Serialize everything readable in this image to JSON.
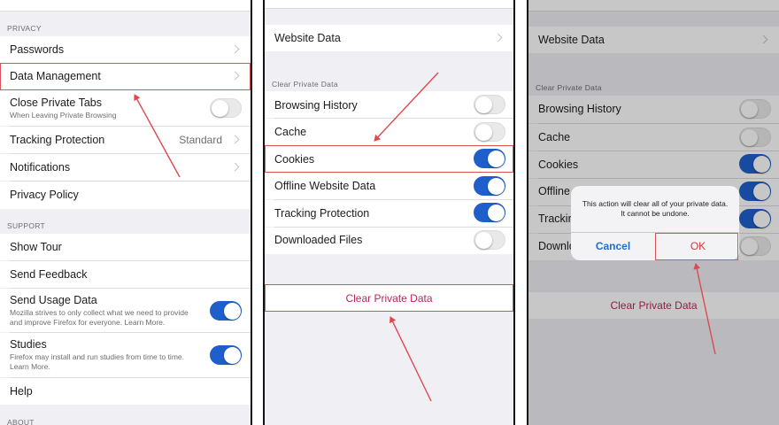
{
  "colors": {
    "accent": "#1f5fcc",
    "highlight": "#d9545a",
    "destructive": "#c0245c"
  },
  "panel1": {
    "privacy_header": "PRIVACY",
    "passwords": "Passwords",
    "data_management": "Data Management",
    "close_private_tabs": "Close Private Tabs",
    "close_private_tabs_sub": "When Leaving Private Browsing",
    "tracking_protection": "Tracking Protection",
    "tracking_protection_value": "Standard",
    "notifications": "Notifications",
    "privacy_policy": "Privacy Policy",
    "support_header": "SUPPORT",
    "show_tour": "Show Tour",
    "send_feedback": "Send Feedback",
    "send_usage_data": "Send Usage Data",
    "send_usage_data_sub1": "Mozilla strives to only collect what we need to provide",
    "send_usage_data_sub2": "and improve Firefox for everyone. Learn More.",
    "studies": "Studies",
    "studies_sub1": "Firefox may install and run studies from time to time.",
    "studies_sub2": "Learn More.",
    "help": "Help",
    "about_header": "ABOUT"
  },
  "panel2": {
    "website_data": "Website Data",
    "clear_header": "Clear Private Data",
    "browsing_history": "Browsing History",
    "cache": "Cache",
    "cookies": "Cookies",
    "offline_website_data": "Offline Website Data",
    "tracking_protection": "Tracking Protection",
    "downloaded_files": "Downloaded Files",
    "clear_button": "Clear Private Data"
  },
  "panel3": {
    "website_data": "Website Data",
    "clear_header": "Clear Private Data",
    "browsing_history": "Browsing History",
    "cache": "Cache",
    "cookies": "Cookies",
    "offline": "Offline",
    "tracking": "Trackin",
    "downloaded": "Downlo",
    "clear_button": "Clear Private Data",
    "dialog_message": "This action will clear all of your private data. It cannot be undone.",
    "dialog_cancel": "Cancel",
    "dialog_ok": "OK"
  }
}
